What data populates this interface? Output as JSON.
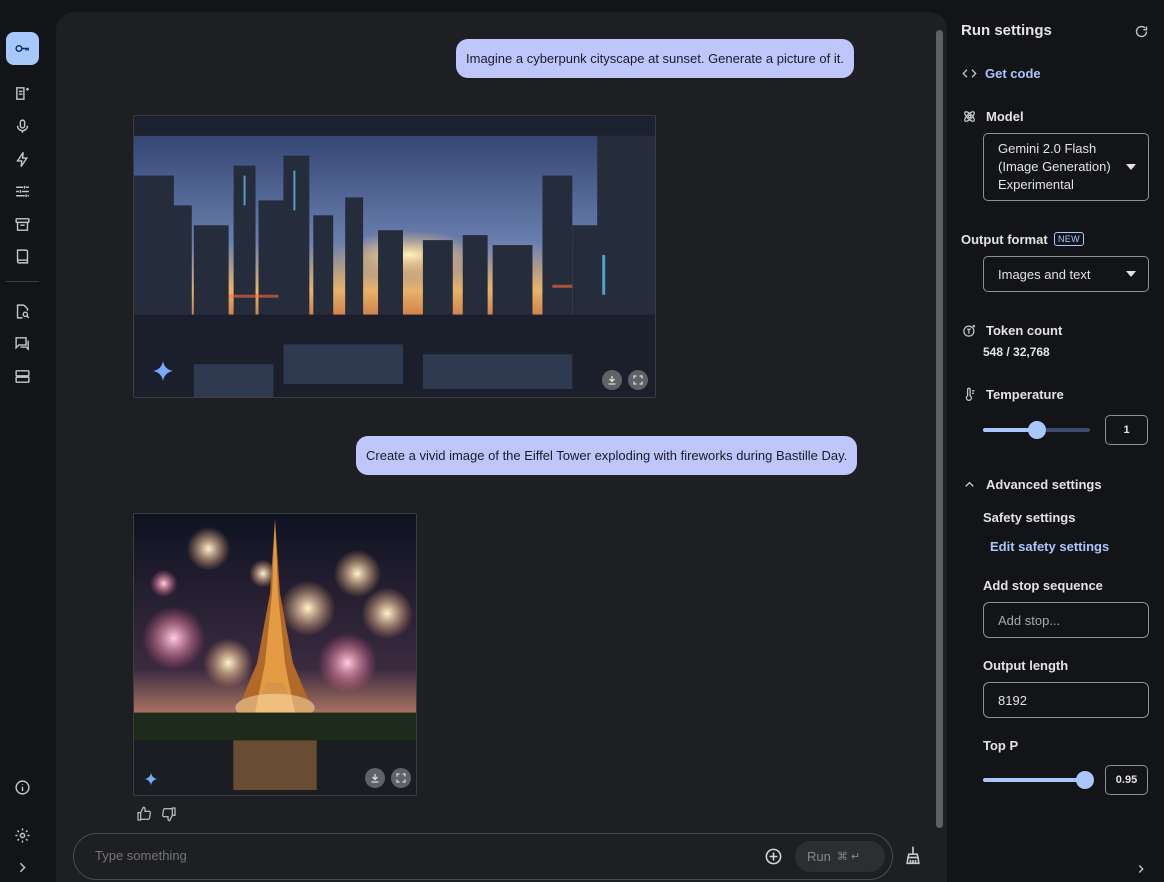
{
  "chat": {
    "messages": [
      {
        "role": "user",
        "text": "Imagine a cyberpunk cityscape at sunset. Generate a picture of it."
      },
      {
        "role": "model",
        "image": "cyberpunk-cityscape-image"
      },
      {
        "role": "user",
        "text": "Create a vivid image of the Eiffel Tower exploding with fireworks during Bastille Day."
      },
      {
        "role": "model",
        "image": "eiffel-tower-fireworks-image"
      }
    ]
  },
  "prompt": {
    "placeholder": "Type something",
    "run_label": "Run",
    "run_shortcut": "⌘ ↵"
  },
  "settings": {
    "title": "Run settings",
    "get_code": "Get code",
    "model_label": "Model",
    "model_value": "Gemini 2.0 Flash (Image Generation) Experimental",
    "output_format_label": "Output format",
    "new_badge": "NEW",
    "output_format_value": "Images and text",
    "token_count_label": "Token count",
    "token_count_value": "548 / 32,768",
    "temperature_label": "Temperature",
    "temperature_value": "1",
    "temperature_fraction": 0.5,
    "advanced_label": "Advanced settings",
    "safety_label": "Safety settings",
    "edit_safety": "Edit safety settings",
    "stop_seq_label": "Add stop sequence",
    "stop_seq_placeholder": "Add stop...",
    "output_length_label": "Output length",
    "output_length_value": "8192",
    "top_p_label": "Top P",
    "top_p_value": "0.95",
    "top_p_fraction": 0.95
  },
  "colors": {
    "accent": "#a8c7fa",
    "user_bubble": "#bfc6fb",
    "panel_bg": "#1e1f22",
    "page_bg": "#131418"
  },
  "icons": [
    "key-icon",
    "new-chat-icon",
    "mic-icon",
    "bolt-icon",
    "tune-icon",
    "archive-icon",
    "book-icon",
    "search-doc-icon",
    "chat-icon",
    "storage-icon",
    "info-icon",
    "settings-icon",
    "expand-icon"
  ]
}
